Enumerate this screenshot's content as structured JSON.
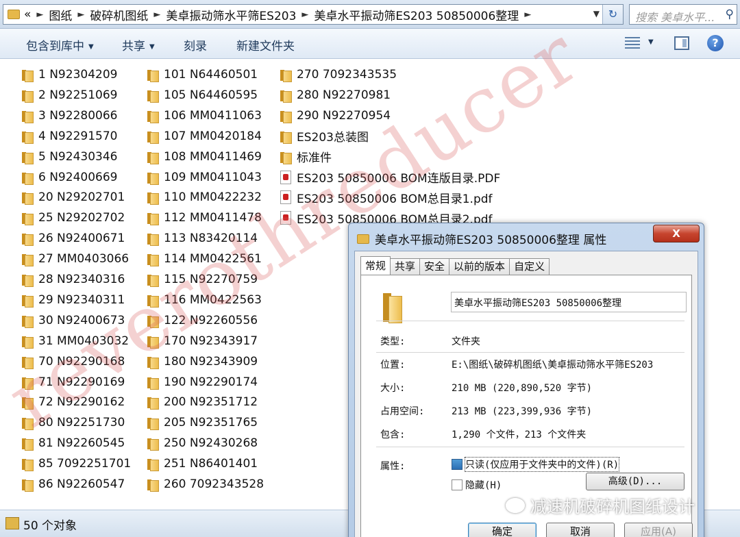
{
  "address": {
    "crumbs": [
      "«",
      "图纸",
      "破碎机图纸",
      "美卓振动筛水平筛ES203",
      "美卓水平振动筛ES203 50850006整理"
    ],
    "search_placeholder": "搜索 美卓水平..."
  },
  "commands": {
    "include_library": "包含到库中",
    "share": "共享",
    "burn": "刻录",
    "new_folder": "新建文件夹"
  },
  "files": {
    "col1": [
      "1 N92304209",
      "2 N92251069",
      "3 N92280066",
      "4 N92291570",
      "5 N92430346",
      "6 N92400669",
      "20 N29202701",
      "25 N29202702",
      "26 N92400671",
      "27 MM0403066",
      "28 N92340316",
      "29 N92340311",
      "30 N92400673",
      "31 MM0403032",
      "70 N92290168",
      "71 N92290169",
      "72 N92290162",
      "80 N92251730",
      "81 N92260545",
      "85 7092251701",
      "86 N92260547"
    ],
    "col2": [
      "101 N64460501",
      "105 N64460595",
      "106 MM0411063",
      "107 MM0420184",
      "108 MM0411469",
      "109 MM0411043",
      "110 MM0422232",
      "112 MM0411478",
      "113 N83420114",
      "114 MM0422561",
      "115 N92270759",
      "116 MM0422563",
      "122 N92260556",
      "170 N92343917",
      "180 N92343909",
      "190 N92290174",
      "200 N92351712",
      "205 N92351765",
      "250 N92430268",
      "251 N86401401",
      "260 7092343528"
    ],
    "col3_folders": [
      "270 7092343535",
      "280 N92270981",
      "290 N92270954",
      "ES203总装图",
      "标准件"
    ],
    "col3_pdfs": [
      "ES203  50850006 BOM连版目录.PDF",
      "ES203  50850006 BOM总目录1.pdf",
      "ES203  50850006 BOM总目录2.pdf"
    ]
  },
  "status": {
    "count": "50 个对象"
  },
  "watermark": "reverothreducer",
  "dialog": {
    "title": "美卓水平振动筛ES203 50850006整理 属性",
    "close": "X",
    "tabs": [
      "常规",
      "共享",
      "安全",
      "以前的版本",
      "自定义"
    ],
    "name": "美卓水平振动筛ES203 50850006整理",
    "props": {
      "type_label": "类型:",
      "type_value": "文件夹",
      "location_label": "位置:",
      "location_value": "E:\\图纸\\破碎机图纸\\美卓振动筛水平筛ES203",
      "size_label": "大小:",
      "size_value": "210 MB (220,890,520 字节)",
      "disk_label": "占用空间:",
      "disk_value": "213 MB (223,399,936 字节)",
      "contains_label": "包含:",
      "contains_value": "1,290 个文件，213 个文件夹",
      "attr_label": "属性:",
      "readonly": "只读(仅应用于文件夹中的文件)(R)",
      "hidden": "隐藏(H)",
      "advanced": "高级(D)..."
    },
    "buttons": {
      "ok": "确定",
      "cancel": "取消",
      "apply": "应用(A)"
    }
  },
  "wechat_watermark": "减速机破碎机图纸设计"
}
